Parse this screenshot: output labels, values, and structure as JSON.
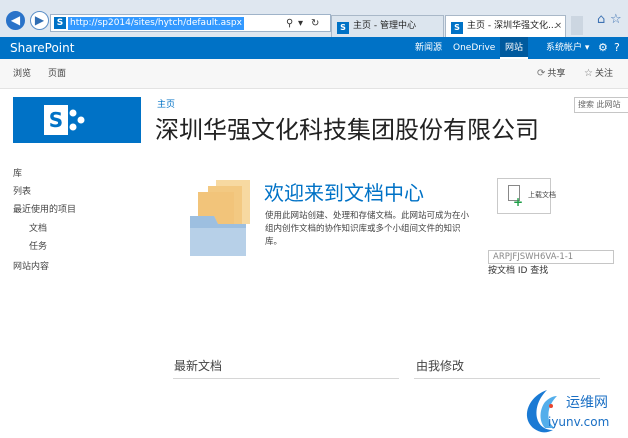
{
  "browser": {
    "address_url": "http://sp2014/sites/hytch/default.aspx",
    "tabs": [
      {
        "label": "主页 - 管理中心"
      },
      {
        "label": "主页 - 深圳华强文化..."
      }
    ],
    "tab_close": "×",
    "icons": [
      "back-icon",
      "forward-icon",
      "search-icon",
      "refresh-icon",
      "home-icon",
      "favorites-icon",
      "tools-icon"
    ]
  },
  "suite_bar": {
    "brand": "SharePoint",
    "links": {
      "newsfeed": "新闻源",
      "onedrive": "OneDrive",
      "sites": "网站",
      "account": "系统帐户 ▾",
      "gear": "⚙",
      "help": "?"
    }
  },
  "ribbon": {
    "tabs": {
      "browse": "浏览",
      "page": "页面"
    },
    "actions": {
      "share": "共享",
      "follow": "关注"
    }
  },
  "header": {
    "breadcrumb": "主页",
    "site_title": "深圳华强文化科技集团股份有限公司",
    "search_placeholder": "搜索 此网站"
  },
  "quick_launch": {
    "items": [
      {
        "label": "库"
      },
      {
        "label": "列表"
      },
      {
        "label": "最近使用的项目"
      },
      {
        "label": "文档"
      },
      {
        "label": "任务"
      },
      {
        "label": "网站内容"
      }
    ]
  },
  "welcome": {
    "title": "欢迎来到文档中心",
    "description": "使用此网站创建、处理和存储文档。此网站可成为在小组内创作文档的协作知识库或多个小组间文件的知识库。"
  },
  "upload": {
    "label": "上载文档"
  },
  "doc_id": {
    "value": "ARPJFJSWH6VA-1-1",
    "find_label": "按文档 ID 查找"
  },
  "sections": {
    "recent": "最新文档",
    "mine": "由我修改"
  },
  "watermark": {
    "name": "运维网",
    "domain": "iyunv.com"
  },
  "colors": {
    "suite_bar": "#0072c6",
    "accent": "#0072c6",
    "folder": "#f2c47a"
  }
}
